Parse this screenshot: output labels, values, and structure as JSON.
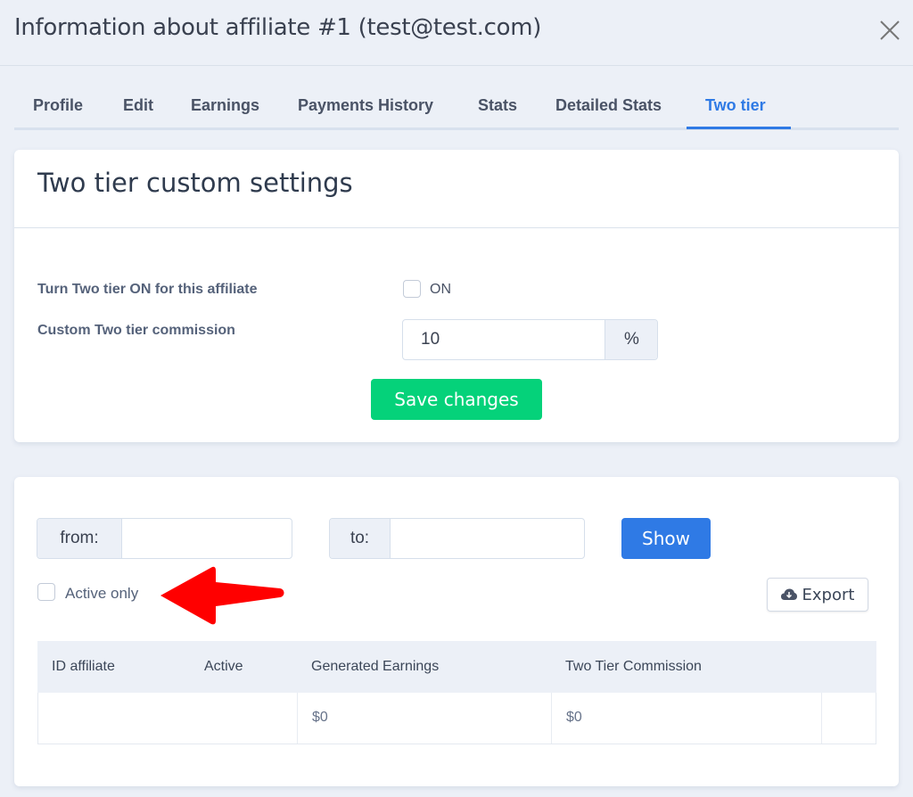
{
  "modal": {
    "title": "Information about affiliate #1 (test@test.com)",
    "close_icon": "close-icon"
  },
  "tabs": [
    {
      "label": "Profile",
      "active": false
    },
    {
      "label": "Edit",
      "active": false
    },
    {
      "label": "Earnings",
      "active": false
    },
    {
      "label": "Payments History",
      "active": false
    },
    {
      "label": "Stats",
      "active": false
    },
    {
      "label": "Detailed Stats",
      "active": false
    },
    {
      "label": "Two tier",
      "active": true
    }
  ],
  "settings": {
    "title": "Two tier custom settings",
    "turn_on_label": "Turn Two tier ON for this affiliate",
    "turn_on_checkbox_label": "ON",
    "turn_on_checked": false,
    "commission_label": "Custom Two tier commission",
    "commission_value": "10",
    "commission_suffix": "%",
    "save_label": "Save changes"
  },
  "filters": {
    "from_label": "from:",
    "from_value": "",
    "to_label": "to:",
    "to_value": "",
    "show_label": "Show",
    "active_only_label": "Active only",
    "active_only_checked": false,
    "export_label": "Export",
    "export_icon": "cloud-download-icon"
  },
  "table": {
    "columns": [
      "ID affiliate",
      "Active",
      "Generated Earnings",
      "Two Tier Commission"
    ],
    "rows": [
      {
        "id": "",
        "active": "",
        "generated_earnings": "$0",
        "two_tier_commission": "$0"
      }
    ]
  },
  "annotation": {
    "arrow_color": "#ff0000",
    "points_to": "Active only"
  },
  "colors": {
    "accent": "#2f7ae5",
    "success": "#05d27a",
    "background": "#ecf0f7"
  }
}
